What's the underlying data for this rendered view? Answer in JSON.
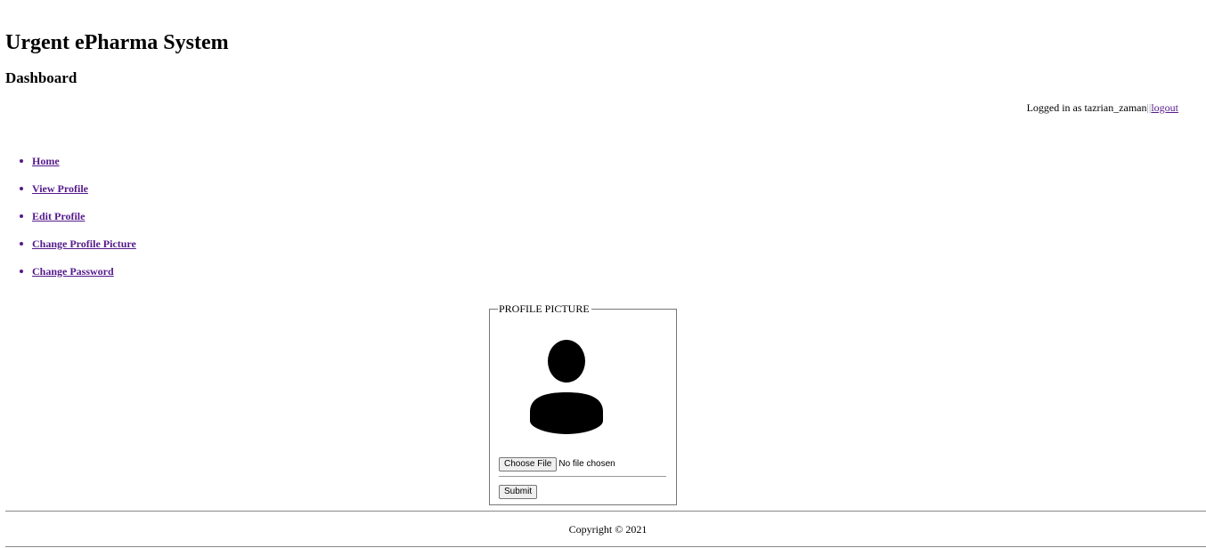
{
  "header": {
    "site_title": "Urgent ePharma System",
    "page_title": "Dashboard"
  },
  "login": {
    "prefix": "Logged in as tazrian_zaman",
    "separator": "||",
    "logout_label": "logout"
  },
  "nav": {
    "items": [
      {
        "label": "Home"
      },
      {
        "label": "View Profile"
      },
      {
        "label": "Edit Profile"
      },
      {
        "label": "Change Profile Picture"
      },
      {
        "label": "Change Password"
      }
    ]
  },
  "profile_picture": {
    "legend": "PROFILE PICTURE",
    "avatar_icon": "user-silhouette-icon",
    "choose_file_label": "Choose File",
    "file_status": "No file chosen",
    "submit_label": "Submit"
  },
  "footer": {
    "copyright": "Copyright © 2021"
  },
  "colors": {
    "link_visited": "#551a8b"
  }
}
